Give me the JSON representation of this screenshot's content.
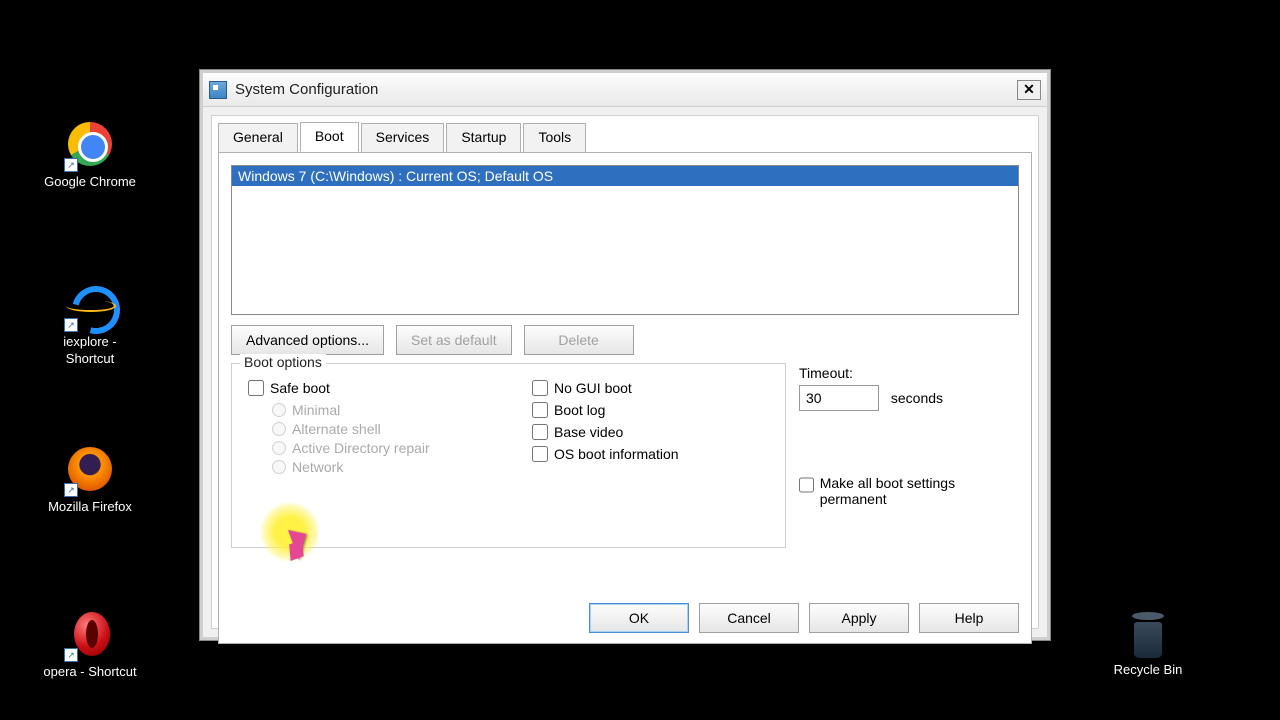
{
  "desktop": {
    "icons": [
      {
        "label": "Google Chrome"
      },
      {
        "label": "iexplore - Shortcut"
      },
      {
        "label": "Mozilla Firefox"
      },
      {
        "label": "opera - Shortcut"
      }
    ],
    "recycle": "Recycle Bin"
  },
  "dialog": {
    "title": "System Configuration",
    "tabs": [
      "General",
      "Boot",
      "Services",
      "Startup",
      "Tools"
    ],
    "active_tab": "Boot",
    "os_entry": "Windows 7 (C:\\Windows) : Current OS; Default OS",
    "buttons": {
      "advanced": "Advanced options...",
      "set_default": "Set as default",
      "delete": "Delete"
    },
    "boot_options": {
      "legend": "Boot options",
      "safe_boot": "Safe boot",
      "minimal": "Minimal",
      "alt_shell": "Alternate shell",
      "ad_repair": "Active Directory repair",
      "network": "Network",
      "no_gui": "No GUI boot",
      "boot_log": "Boot log",
      "base_video": "Base video",
      "os_boot_info": "OS boot information"
    },
    "timeout": {
      "label": "Timeout:",
      "value": "30",
      "unit": "seconds"
    },
    "permanent": "Make all boot settings permanent",
    "bottom": {
      "ok": "OK",
      "cancel": "Cancel",
      "apply": "Apply",
      "help": "Help"
    }
  }
}
